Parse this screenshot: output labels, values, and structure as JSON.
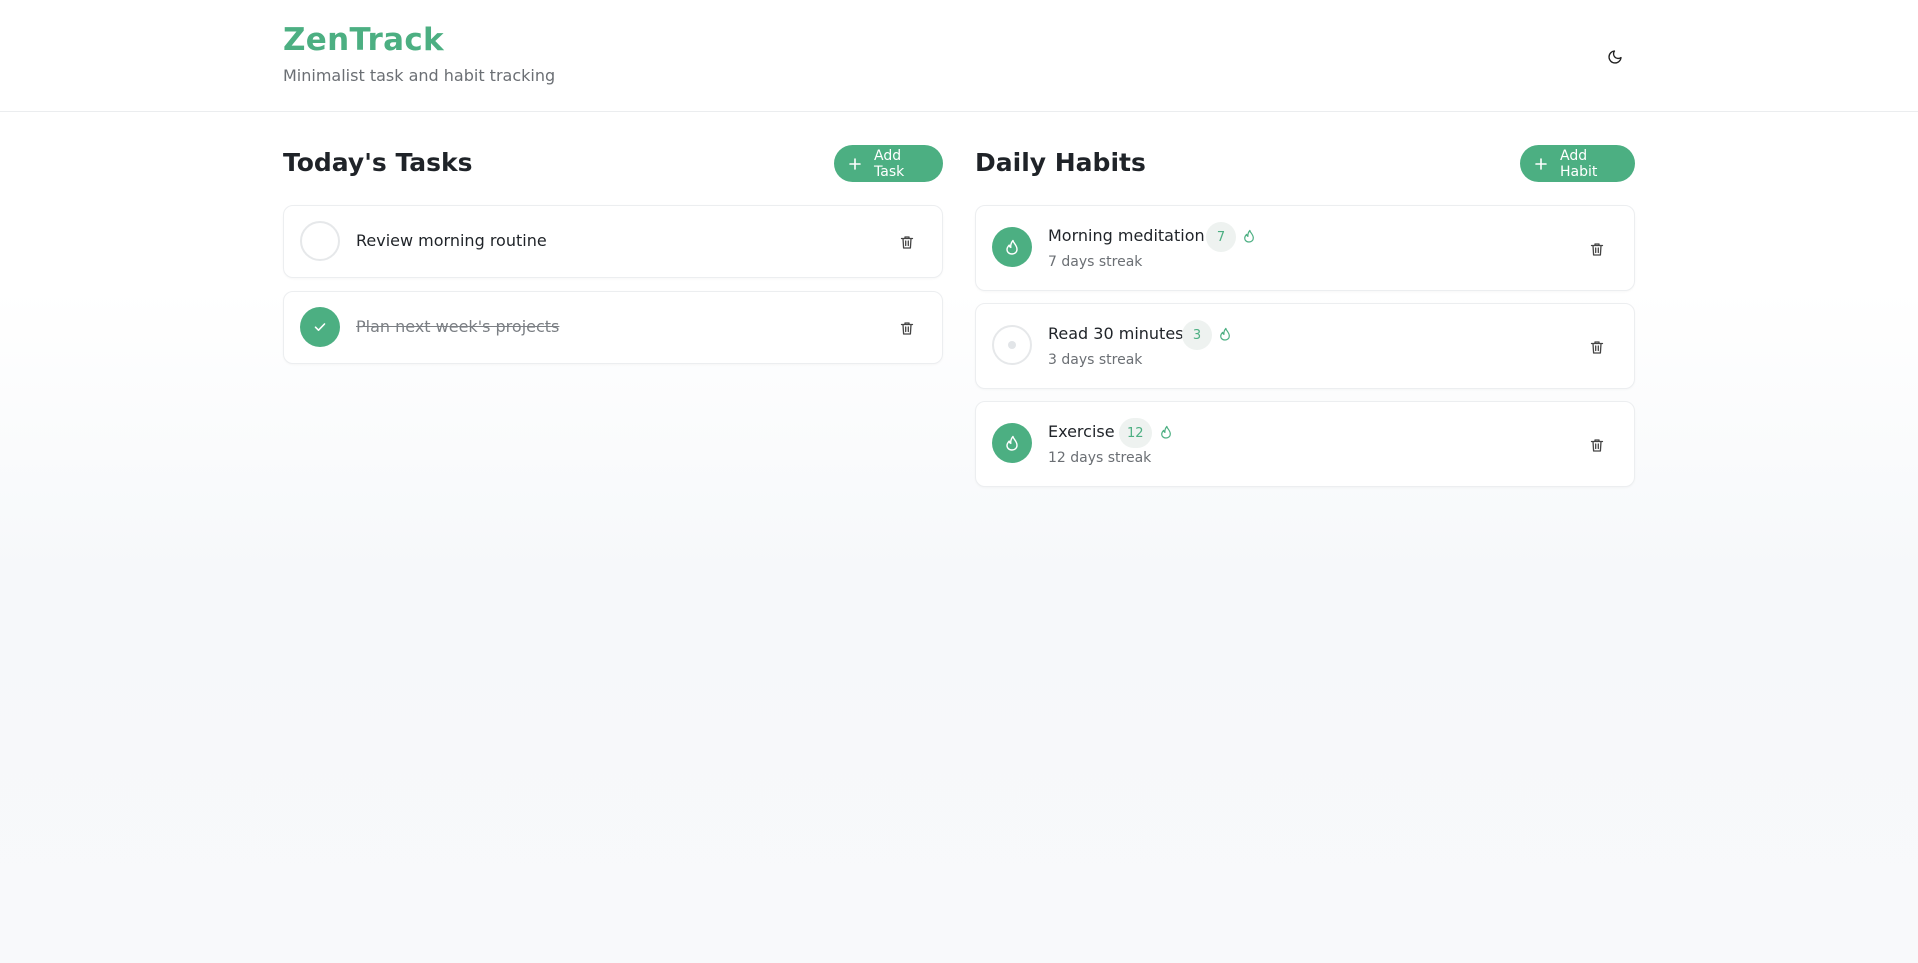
{
  "header": {
    "title": "ZenTrack",
    "subtitle": "Minimalist task and habit tracking",
    "theme_icon": "moon-icon"
  },
  "tasks": {
    "title": "Today's Tasks",
    "add_label": "Add Task",
    "items": [
      {
        "text": "Review morning routine",
        "completed": false
      },
      {
        "text": "Plan next week's projects",
        "completed": true
      }
    ]
  },
  "habits": {
    "title": "Daily Habits",
    "add_label": "Add Habit",
    "items": [
      {
        "name": "Morning meditation",
        "streak": "7",
        "streak_text": "7 days streak",
        "done_today": true
      },
      {
        "name": "Read 30 minutes",
        "streak": "3",
        "streak_text": "3 days streak",
        "done_today": false
      },
      {
        "name": "Exercise",
        "streak": "12",
        "streak_text": "12 days streak",
        "done_today": true
      }
    ]
  },
  "colors": {
    "accent": "#4caf82",
    "text": "#1f2328",
    "muted": "#6b6f74"
  }
}
